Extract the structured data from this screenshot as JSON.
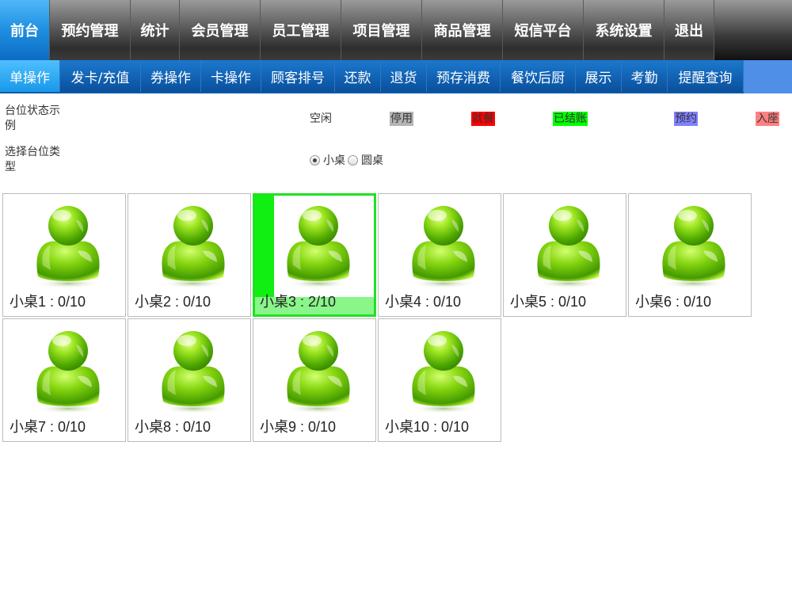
{
  "top_nav": [
    {
      "label": "前台",
      "active": true
    },
    {
      "label": "预约管理"
    },
    {
      "label": "统计"
    },
    {
      "label": "会员管理"
    },
    {
      "label": "员工管理"
    },
    {
      "label": "项目管理"
    },
    {
      "label": "商品管理"
    },
    {
      "label": "短信平台"
    },
    {
      "label": "系统设置"
    },
    {
      "label": "退出"
    }
  ],
  "sub_nav": [
    {
      "label": "单操作",
      "active": true
    },
    {
      "label": "发卡/充值"
    },
    {
      "label": "券操作"
    },
    {
      "label": "卡操作"
    },
    {
      "label": "顾客排号"
    },
    {
      "label": "还款"
    },
    {
      "label": "退货"
    },
    {
      "label": "预存消费"
    },
    {
      "label": "餐饮后厨"
    },
    {
      "label": "展示"
    },
    {
      "label": "考勤"
    },
    {
      "label": "提醒查询"
    }
  ],
  "status_section": {
    "label": "台位状态示例",
    "legend": [
      {
        "label": "空闲",
        "color": "#ffffff"
      },
      {
        "label": "停用",
        "color": "#b4b4b4"
      },
      {
        "label": "就餐",
        "color": "#ff0000"
      },
      {
        "label": "已结账",
        "color": "#00ff00"
      },
      {
        "label": "预约",
        "color": "#8080ff"
      },
      {
        "label": "入座",
        "color": "#ff8080"
      }
    ]
  },
  "type_section": {
    "label": "选择台位类型",
    "options": [
      {
        "label": "小桌",
        "checked": true
      },
      {
        "label": "圆桌",
        "checked": false
      }
    ]
  },
  "tables": [
    {
      "label": "小桌1 : 0/10",
      "occupied": false
    },
    {
      "label": "小桌2 : 0/10",
      "occupied": false
    },
    {
      "label": "小桌3 : 2/10",
      "occupied": true
    },
    {
      "label": "小桌4 : 0/10",
      "occupied": false
    },
    {
      "label": "小桌5 : 0/10",
      "occupied": false
    },
    {
      "label": "小桌6 : 0/10",
      "occupied": false
    },
    {
      "label": "小桌7 : 0/10",
      "occupied": false
    },
    {
      "label": "小桌8 : 0/10",
      "occupied": false
    },
    {
      "label": "小桌9 : 0/10",
      "occupied": false
    },
    {
      "label": "小桌10 : 0/10",
      "occupied": false
    }
  ],
  "icons": {
    "table_avatar": "user-avatar-icon"
  }
}
